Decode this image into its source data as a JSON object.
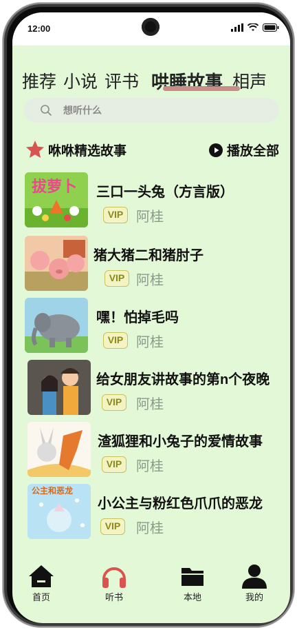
{
  "status_bar": {
    "time": "12:00"
  },
  "tabs": [
    {
      "label": "推荐",
      "active": false
    },
    {
      "label": "小说",
      "active": false
    },
    {
      "label": "评书",
      "active": false
    },
    {
      "label": "哄睡故事",
      "active": true
    },
    {
      "label": "相声",
      "active": false
    }
  ],
  "search": {
    "placeholder": "想听什么"
  },
  "section": {
    "title": "咻咻精选故事",
    "play_all_label": "播放全部"
  },
  "stories": [
    {
      "title": "三口一头兔（方言版）",
      "badge": "VIP",
      "author": "阿桂"
    },
    {
      "title": "猪大猪二和猪肘子",
      "badge": "VIP",
      "author": "阿桂"
    },
    {
      "title": "嘿！怕掉毛吗",
      "badge": "VIP",
      "author": "阿桂"
    },
    {
      "title": "给女朋友讲故事的第n个夜晚",
      "badge": "VIP",
      "author": "阿桂"
    },
    {
      "title": "渣狐狸和小兔子的爱情故事",
      "badge": "VIP",
      "author": "阿桂"
    },
    {
      "title": "小公主与粉红色爪爪的恶龙",
      "badge": "VIP",
      "author": "阿桂"
    }
  ],
  "covers": [
    {
      "text": "拔萝卜"
    },
    {
      "text": ""
    },
    {
      "text": ""
    },
    {
      "text": ""
    },
    {
      "text": ""
    },
    {
      "text": "公主和恶龙"
    }
  ],
  "bottom_nav": [
    {
      "label": "首页",
      "icon": "home-icon"
    },
    {
      "label": "听书",
      "icon": "headphones-icon",
      "color": "#d9534f"
    },
    {
      "label": "本地",
      "icon": "folder-icon"
    },
    {
      "label": "我的",
      "icon": "person-icon"
    }
  ],
  "colors": {
    "background": "#e3f8d7",
    "accent": "#c98c87",
    "star": "#d9534f",
    "vip": "#c9c25a"
  }
}
